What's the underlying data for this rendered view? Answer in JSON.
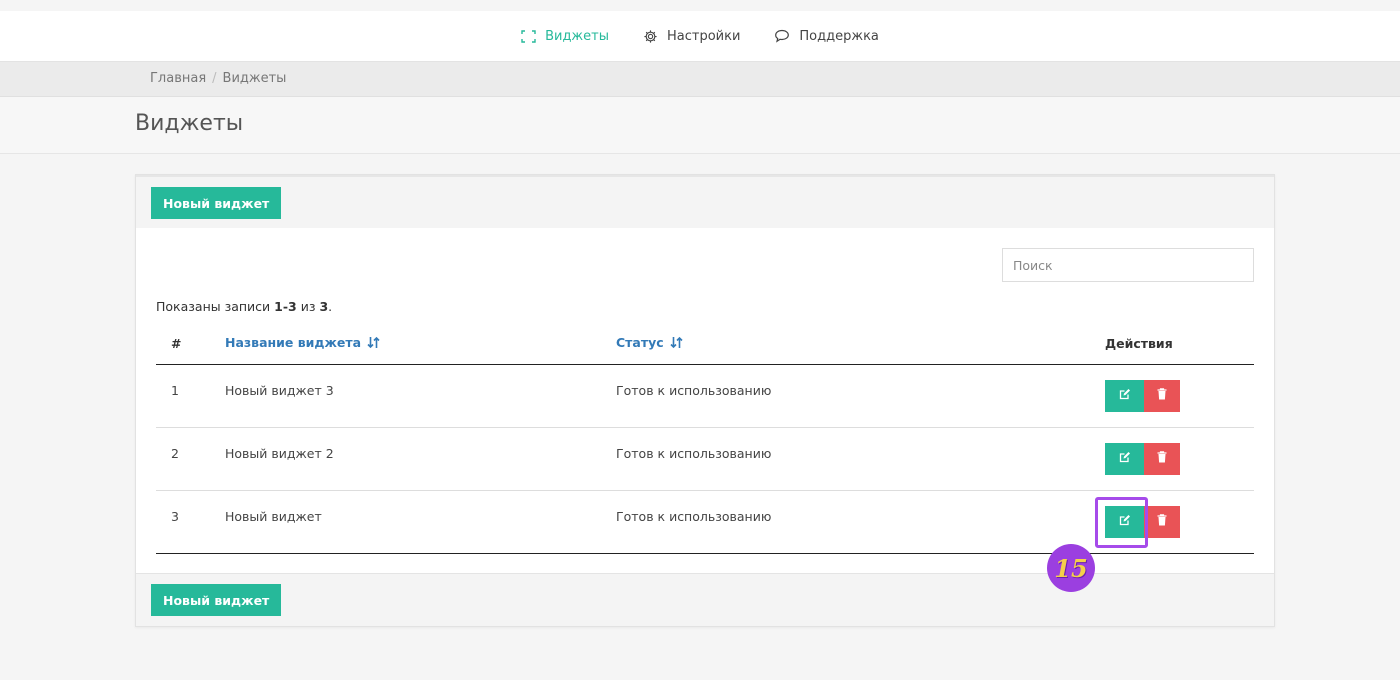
{
  "nav": {
    "items": [
      {
        "label": "Виджеты",
        "icon": "expand-icon",
        "active": true
      },
      {
        "label": "Настройки",
        "icon": "gear-icon",
        "active": false
      },
      {
        "label": "Поддержка",
        "icon": "comment-icon",
        "active": false
      }
    ]
  },
  "breadcrumb": {
    "home": "Главная",
    "separator": "/",
    "current": "Виджеты"
  },
  "page": {
    "title": "Виджеты"
  },
  "toolbar": {
    "new_label": "Новый виджет"
  },
  "search": {
    "placeholder": "Поиск"
  },
  "summary": {
    "prefix": "Показаны записи ",
    "range": "1-3",
    "middle": " из ",
    "total": "3",
    "suffix": "."
  },
  "table": {
    "headers": {
      "num": "#",
      "name": "Название виджета",
      "status": "Статус",
      "actions": "Действия"
    },
    "rows": [
      {
        "num": "1",
        "name": "Новый виджет 3",
        "status": "Готов к использованию"
      },
      {
        "num": "2",
        "name": "Новый виджет 2",
        "status": "Готов к использованию"
      },
      {
        "num": "3",
        "name": "Новый виджет",
        "status": "Готов к использованию"
      }
    ]
  },
  "annotation": {
    "step": "15"
  },
  "colors": {
    "accent": "#26b99a",
    "danger": "#e95356",
    "link": "#337ab7",
    "highlight": "#a64bea"
  }
}
